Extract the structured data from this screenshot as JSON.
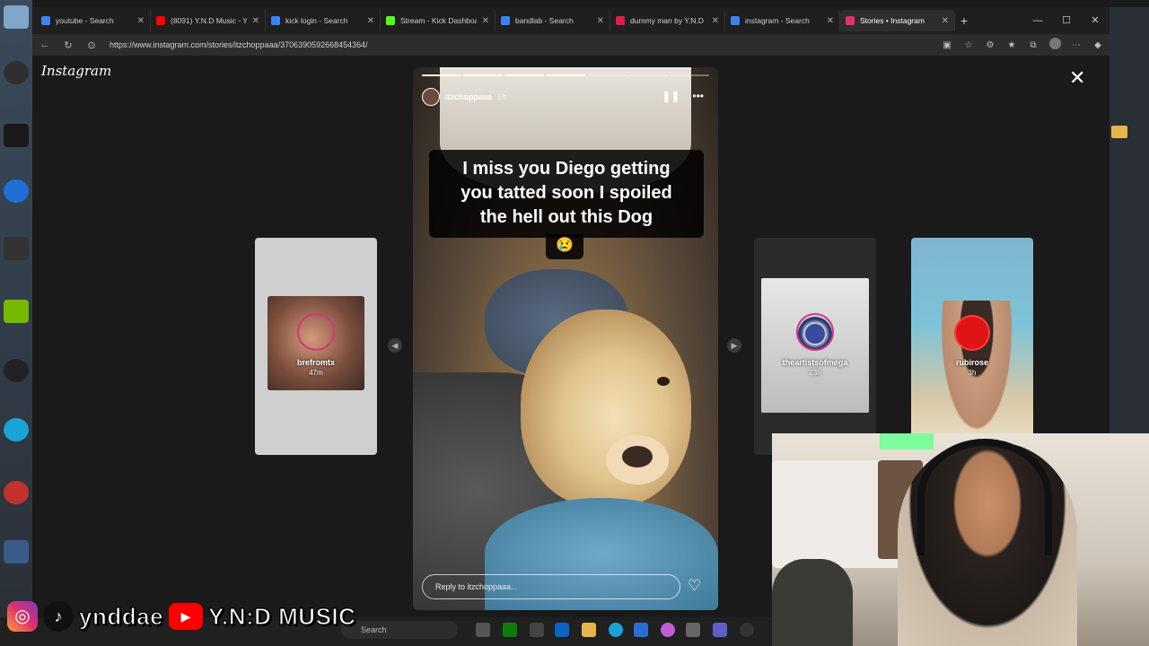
{
  "browser": {
    "tabs": [
      {
        "label": "youtube - Search",
        "color": "#3b82f6"
      },
      {
        "label": "(8091) Y.N.D Music - You",
        "color": "#ff0000"
      },
      {
        "label": "kick login - Search",
        "color": "#3b82f6"
      },
      {
        "label": "Stream - Kick Dashboard",
        "color": "#53fc18"
      },
      {
        "label": "bandlab - Search",
        "color": "#3b82f6"
      },
      {
        "label": "dummy man by Y.N.D | ",
        "color": "#e11d48"
      },
      {
        "label": "instagram - Search",
        "color": "#3b82f6"
      },
      {
        "label": "Stories • Instagram",
        "color": "#e1306c"
      }
    ],
    "url": "https://www.instagram.com/stories/itzchoppaaa/3706390592668454364/"
  },
  "instagram": {
    "logo": "Instagram",
    "story": {
      "username": "itzchoppaaa",
      "time": "1h",
      "caption_lines": [
        "I miss you Diego getting",
        "you tatted soon I spoiled",
        "the hell out this Dog"
      ],
      "emoji": "😢",
      "reply_placeholder": "Reply to itzchoppaaa...",
      "progress_total": 7,
      "progress_done": 4
    },
    "previews": [
      {
        "name": "brefromtx",
        "time": "47m"
      },
      {
        "name": "theartistsofmega",
        "time": "23h"
      },
      {
        "name": "rubirose",
        "time": "3h"
      }
    ]
  },
  "taskbar": {
    "search_placeholder": "Search"
  },
  "social": {
    "tiktok_handle": "ynddae",
    "youtube_channel": "Y.N:D MUSIC"
  },
  "colors": {
    "accent": "#e1306c",
    "background": "#1a1a1a"
  }
}
